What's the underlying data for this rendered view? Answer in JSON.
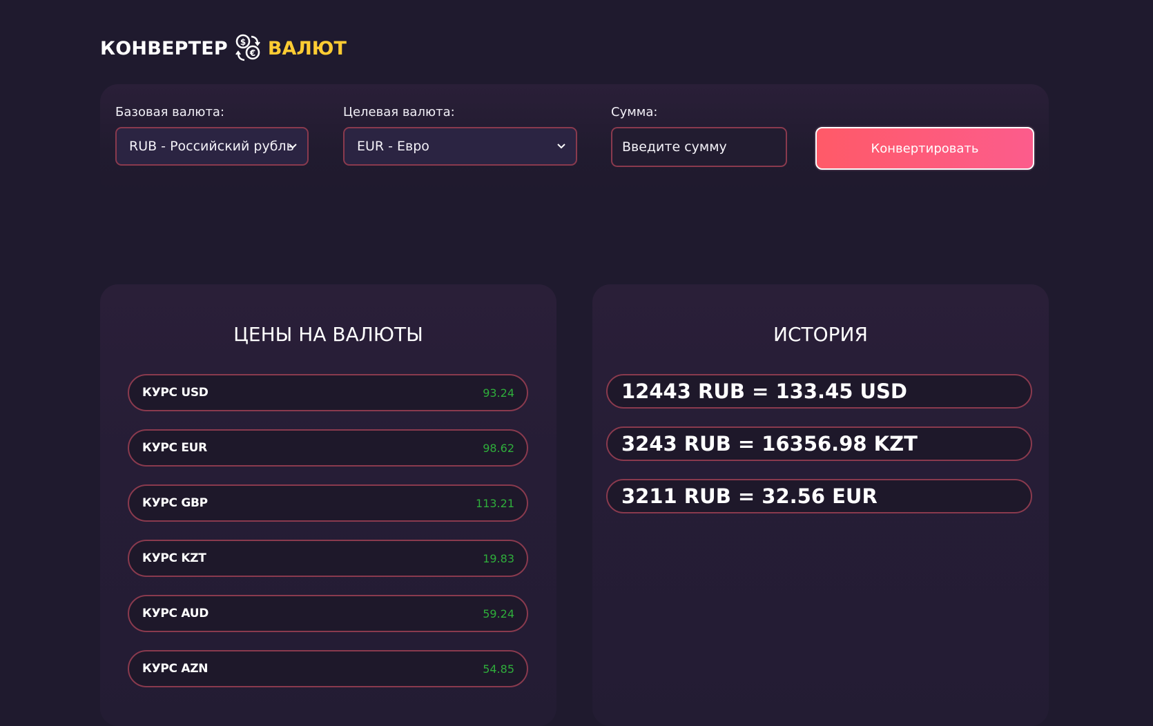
{
  "header": {
    "title_part1": "КОНВЕРТЕР",
    "title_part2": "ВАЛЮТ",
    "icon": "currency-exchange-icon"
  },
  "converter": {
    "base_label": "Базовая валюта:",
    "base_value": "RUB - Российский рубль",
    "target_label": "Целевая валюта:",
    "target_value": "EUR - Евро",
    "amount_label": "Сумма:",
    "amount_placeholder": "Введите сумму",
    "convert_button": "Конвертировать"
  },
  "prices": {
    "title": "ЦЕНЫ НА ВАЛЮТЫ",
    "rates": [
      {
        "label": "КУРС USD",
        "value": "93.24"
      },
      {
        "label": "КУРС EUR",
        "value": "98.62"
      },
      {
        "label": "КУРС GBP",
        "value": "113.21"
      },
      {
        "label": "КУРС KZT",
        "value": "19.83"
      },
      {
        "label": "КУРС AUD",
        "value": "59.24"
      },
      {
        "label": "КУРС AZN",
        "value": "54.85"
      }
    ]
  },
  "history": {
    "title": "ИСТОРИЯ",
    "entries": [
      "12443 RUB = 133.45 USD",
      "3243 RUB = 16356.98 KZT",
      "3211 RUB = 32.56 EUR"
    ]
  },
  "colors": {
    "background": "#1f1a2e",
    "accent_yellow": "#ffcc33",
    "border_red": "#8a3a4e",
    "rate_green": "#2fae3b",
    "button_gradient_start": "#ff5a68",
    "button_gradient_end": "#fc5c8c"
  }
}
